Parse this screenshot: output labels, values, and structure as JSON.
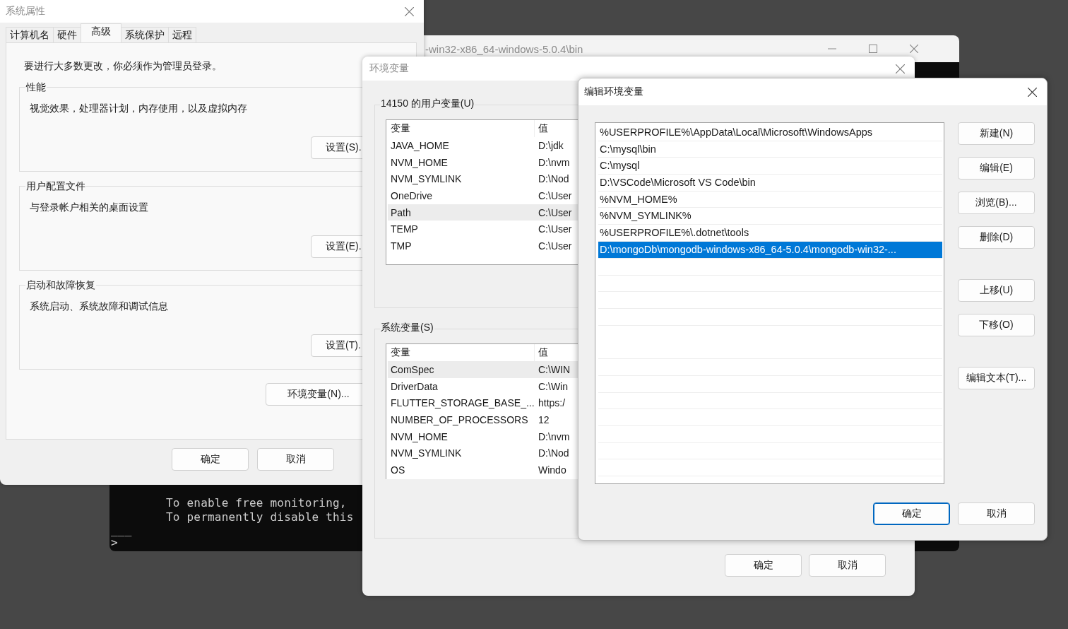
{
  "terminal": {
    "title": "-win32-x86_64-windows-5.0.4\\bin",
    "active": false,
    "lines": [
      {
        "text": "To enable free monitoring,",
        "kind": "output"
      },
      {
        "text": "To permanently disable this",
        "kind": "output"
      },
      {
        "text": "___",
        "kind": "rule"
      },
      {
        "text": ">",
        "kind": "prompt"
      }
    ]
  },
  "system_properties": {
    "title": "系统属性",
    "active": false,
    "tabs": [
      {
        "label": "计算机名",
        "selected": false
      },
      {
        "label": "硬件",
        "selected": false
      },
      {
        "label": "高级",
        "selected": true
      },
      {
        "label": "系统保护",
        "selected": false
      },
      {
        "label": "远程",
        "selected": false
      }
    ],
    "notice": "要进行大多数更改，你必须作为管理员登录。",
    "groups": [
      {
        "title": "性能",
        "description": "视觉效果，处理器计划，内存使用，以及虚拟内存",
        "button": "设置(S)."
      },
      {
        "title": "用户配置文件",
        "description": "与登录帐户相关的桌面设置",
        "button": "设置(E)."
      },
      {
        "title": "启动和故障恢复",
        "description": "系统启动、系统故障和调试信息",
        "button": "设置(T)."
      }
    ],
    "env_button": "环境变量(N)...",
    "buttons": [
      "确定",
      "取消"
    ]
  },
  "environment_variables": {
    "title": "环境变量",
    "active": false,
    "user_variables": {
      "title": "14150 的用户变量(U)",
      "columns": [
        "变量",
        "值"
      ],
      "rows": [
        {
          "name": "JAVA_HOME",
          "value": "D:\\jdk",
          "selected": false
        },
        {
          "name": "NVM_HOME",
          "value": "D:\\nvm",
          "selected": false
        },
        {
          "name": "NVM_SYMLINK",
          "value": "D:\\Nod",
          "selected": false
        },
        {
          "name": "OneDrive",
          "value": "C:\\User",
          "selected": false
        },
        {
          "name": "Path",
          "value": "C:\\User",
          "selected": true
        },
        {
          "name": "TEMP",
          "value": "C:\\User",
          "selected": false
        },
        {
          "name": "TMP",
          "value": "C:\\User",
          "selected": false
        }
      ]
    },
    "system_variables": {
      "title": "系统变量(S)",
      "columns": [
        "变量",
        "值"
      ],
      "rows": [
        {
          "name": "ComSpec",
          "value": "C:\\WIN",
          "selected": true
        },
        {
          "name": "DriverData",
          "value": "C:\\Win",
          "selected": false
        },
        {
          "name": "FLUTTER_STORAGE_BASE_...",
          "value": "https:/",
          "selected": false
        },
        {
          "name": "NUMBER_OF_PROCESSORS",
          "value": "12",
          "selected": false
        },
        {
          "name": "NVM_HOME",
          "value": "D:\\nvm",
          "selected": false
        },
        {
          "name": "NVM_SYMLINK",
          "value": "D:\\Nod",
          "selected": false
        },
        {
          "name": "OS",
          "value": "Windo",
          "selected": false
        }
      ]
    },
    "buttons": [
      "确定",
      "取消"
    ]
  },
  "edit_dialog": {
    "title": "编辑环境变量",
    "active": true,
    "items": [
      {
        "text": "%USERPROFILE%\\AppData\\Local\\Microsoft\\WindowsApps",
        "selected": false
      },
      {
        "text": "C:\\mysql\\bin",
        "selected": false
      },
      {
        "text": "C:\\mysql",
        "selected": false
      },
      {
        "text": "D:\\VSCode\\Microsoft VS Code\\bin",
        "selected": false
      },
      {
        "text": "%NVM_HOME%",
        "selected": false
      },
      {
        "text": "%NVM_SYMLINK%",
        "selected": false
      },
      {
        "text": "%USERPROFILE%\\.dotnet\\tools",
        "selected": false
      },
      {
        "text": "D:\\mongoDb\\mongodb-windows-x86_64-5.0.4\\mongodb-win32-...",
        "selected": true
      }
    ],
    "side_buttons": [
      {
        "label": "新建(N)",
        "kind": "action"
      },
      {
        "label": "编辑(E)",
        "kind": "action"
      },
      {
        "label": "浏览(B)...",
        "kind": "action"
      },
      {
        "label": "删除(D)",
        "kind": "action"
      },
      {
        "label": "上移(U)",
        "kind": "move"
      },
      {
        "label": "下移(O)",
        "kind": "move"
      },
      {
        "label": "编辑文本(T)...",
        "kind": "text"
      }
    ],
    "buttons": [
      {
        "label": "确定",
        "default": true
      },
      {
        "label": "取消",
        "default": false
      }
    ]
  }
}
